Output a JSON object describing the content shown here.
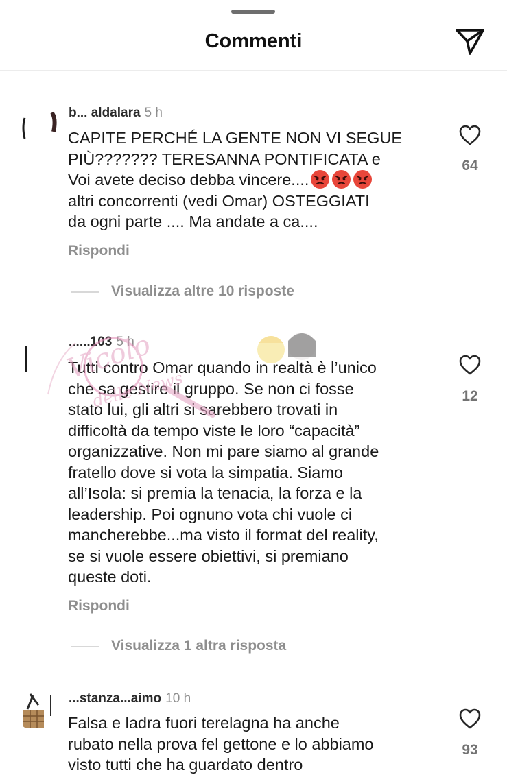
{
  "header": {
    "title": "Commenti"
  },
  "comments": [
    {
      "username": "b... aldalara",
      "time": "5 h",
      "lines": [
        "CAPITE PERCHÉ LA GENTE NON VI SEGUE",
        "PIÙ??????? TERESANNA PONTIFICATA  e",
        "Voi avete deciso debba vincere....",
        "altri concorrenti (vedi Omar) OSTEGGIATI",
        "da ogni parte .... Ma andate a ca...."
      ],
      "reply_label": "Rispondi",
      "more_replies": "Visualizza altre 10 risposte",
      "likes": "64"
    },
    {
      "username": "......103",
      "time": "5 h",
      "lines": [
        "Tutti contro Omar quando in realtà è l’unico",
        "che sa gestire il gruppo. Se non ci fosse",
        "stato lui, gli altri si sarebbero trovati in",
        "difficoltà da tempo viste le loro “capacità”",
        "organizzative. Non mi pare siamo al grande",
        "fratello dove si vota la simpatia. Siamo",
        "all’Isola: si premia la tenacia, la forza e la",
        "leadership. Poi ognuno vota chi vuole ci",
        "mancherebbe...ma visto il format del reality,",
        "se si vuole essere obiettivi, si premiano",
        "queste doti."
      ],
      "reply_label": "Rispondi",
      "more_replies": "Visualizza 1 altra risposta",
      "likes": "12"
    },
    {
      "username": "...stanza...aimo",
      "time": "10 h",
      "lines": [
        "Falsa e ladra fuori terelagna ha anche",
        "rubato nella prova fel gettone e lo abbiamo",
        "visto tutti che ha guardato dentro"
      ],
      "likes": "93"
    }
  ],
  "watermark": {
    "text": "Vicolo delle News"
  },
  "colors": {
    "heart_outline": "#262626",
    "muted": "#8e8e8e",
    "angry_emoji": "#e8463a"
  },
  "icons": {
    "send": "send-icon",
    "like": "heart-icon",
    "angry": "angry-face-emoji"
  }
}
